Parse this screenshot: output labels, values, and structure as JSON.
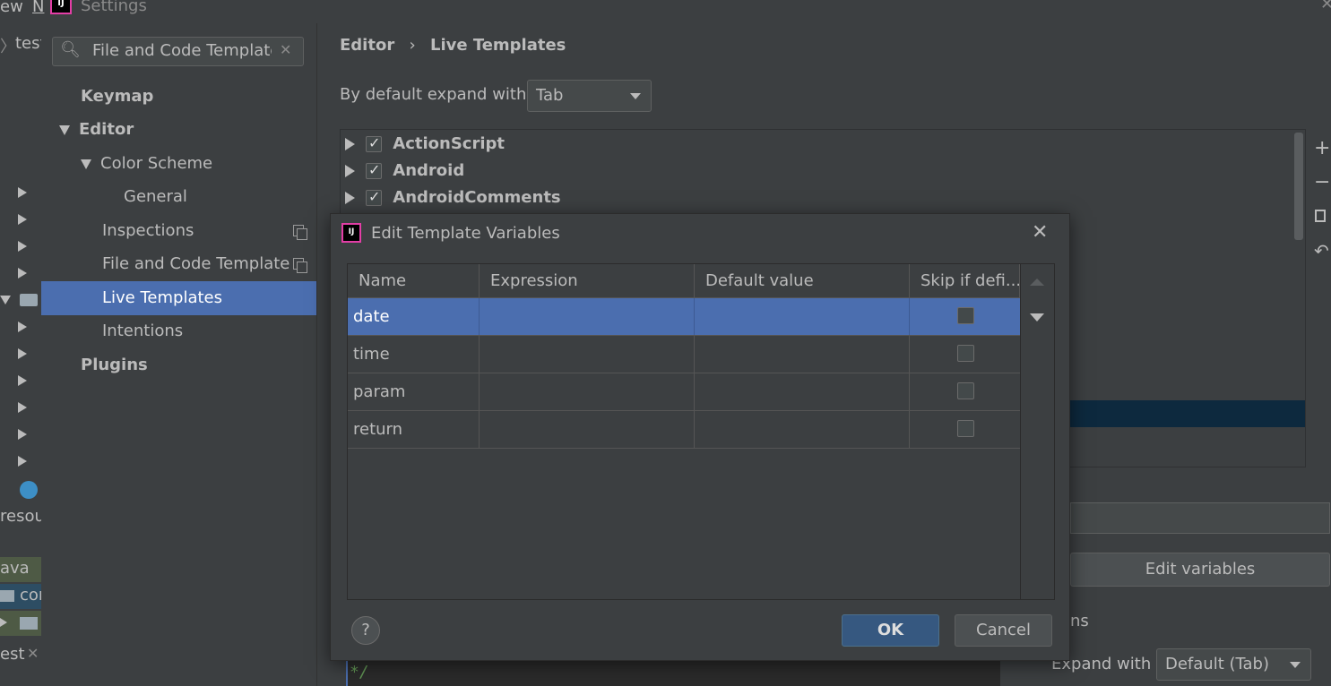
{
  "ide": {
    "menu_fragment_1": "ew",
    "menu_fragment_2": "N",
    "window_title": "Settings",
    "breadcrumb_fragment": "test",
    "project_label_resources": "resour",
    "project_label_java": "ava",
    "project_label_com": "cor",
    "bottom_tab": "est"
  },
  "sidebar": {
    "search_value": "File and Code Template",
    "items": [
      {
        "label": "Keymap"
      },
      {
        "label": "Editor"
      },
      {
        "label": "Color Scheme"
      },
      {
        "label": "General"
      },
      {
        "label": "Inspections"
      },
      {
        "label": "File and Code Template"
      },
      {
        "label": "Live Templates"
      },
      {
        "label": "Intentions"
      },
      {
        "label": "Plugins"
      }
    ]
  },
  "main": {
    "breadcrumb_editor": "Editor",
    "breadcrumb_sep": "›",
    "breadcrumb_page": "Live Templates",
    "expand_label": "By default expand with",
    "expand_value": "Tab",
    "groups": [
      {
        "label": "ActionScript",
        "checked": true
      },
      {
        "label": "Android",
        "checked": true
      },
      {
        "label": "AndroidComments",
        "checked": true
      }
    ],
    "edit_variables_label": "Edit variables",
    "options_fragment": "ns",
    "expand_with_label": "Expand with",
    "expand_with_value": "Default (Tab)",
    "template_text_fragment": "*/"
  },
  "dialog": {
    "title": "Edit Template Variables",
    "columns": [
      "Name",
      "Expression",
      "Default value",
      "Skip if defi..."
    ],
    "rows": [
      {
        "name": "date",
        "expression": "",
        "default": "",
        "skip": false
      },
      {
        "name": "time",
        "expression": "",
        "default": "",
        "skip": false
      },
      {
        "name": "param",
        "expression": "",
        "default": "",
        "skip": false
      },
      {
        "name": "return",
        "expression": "",
        "default": "",
        "skip": false
      }
    ],
    "help_label": "?",
    "ok_label": "OK",
    "cancel_label": "Cancel"
  },
  "colors": {
    "background": "#3c3f41",
    "selection": "#4b6eaf",
    "accent_button": "#365880",
    "text": "#bbbbbb"
  }
}
